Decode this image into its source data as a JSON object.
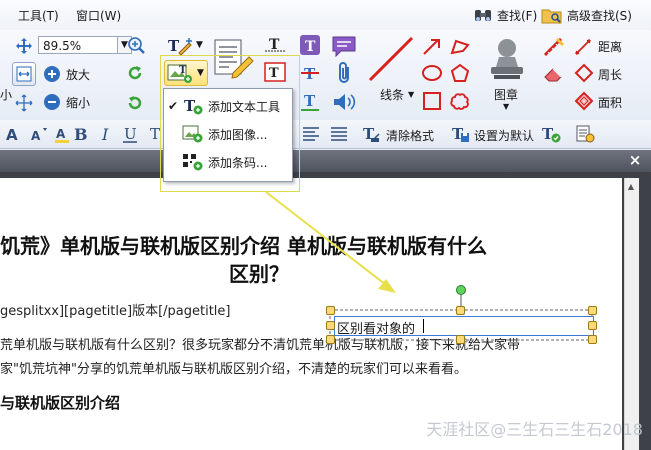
{
  "menubar": {
    "items": [
      "工具(T)",
      "窗口(W)"
    ],
    "find_label": "查找(F)",
    "advanced_find_label": "高级查找(S)"
  },
  "toolbar": {
    "zoom_value": "89.5%",
    "zoom_in_label": "放大",
    "zoom_out_label": "缩小",
    "left_cut_label": "小",
    "lines_label": "线条",
    "stamp_label": "图章",
    "distance_label": "距离",
    "perimeter_label": "周长",
    "area_label": "面积"
  },
  "format_bar": {
    "clear_format_label": "清除格式",
    "set_default_label": "设置为默认"
  },
  "popup_menu": {
    "items": [
      {
        "label": "添加文本工具",
        "checked": true
      },
      {
        "label": "添加图像...",
        "checked": false
      },
      {
        "label": "添加条码...",
        "checked": false
      }
    ]
  },
  "document": {
    "title_line1": "饥荒》单机版与联机版区别介绍 单机版与联机版有什么",
    "title_line2": "区别？",
    "line1": "gesplitxx][pagetitle]版本[/pagetitle]",
    "line2": "荒单机版与联机版有什么区别？很多玩家都分不清饥荒单机版与联机版，接下来就给大家带",
    "line3": "家\"饥荒坑神\"分享的饥荒单机版与联机版区别介绍，不清楚的玩家们可以来看看。",
    "heading2": "与联机版区别介绍",
    "textbox_value": "区别看对象的"
  },
  "watermark": "天涯社区@三生石三生石2018",
  "colors": {
    "accent_red": "#d6211f",
    "selection_blue": "#3d7bd6",
    "arrow_yellow": "#e8e04a"
  }
}
